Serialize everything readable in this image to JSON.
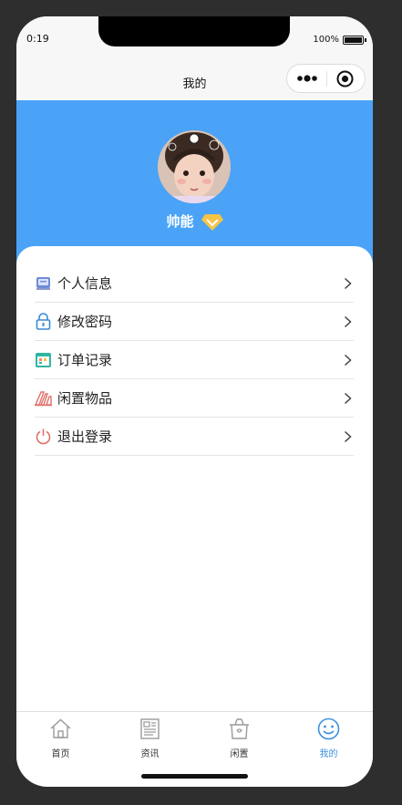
{
  "status_bar": {
    "time": "0:19",
    "battery": "100%"
  },
  "nav": {
    "title": "我的"
  },
  "profile": {
    "username": "帅能"
  },
  "menu": [
    {
      "label": "个人信息",
      "icon": "id-card-icon"
    },
    {
      "label": "修改密码",
      "icon": "lock-icon"
    },
    {
      "label": "订单记录",
      "icon": "calendar-icon"
    },
    {
      "label": "闲置物品",
      "icon": "goods-icon"
    },
    {
      "label": "退出登录",
      "icon": "power-icon"
    }
  ],
  "tabs": [
    {
      "label": "首页",
      "icon": "home-icon",
      "active": false
    },
    {
      "label": "资讯",
      "icon": "news-icon",
      "active": false
    },
    {
      "label": "闲置",
      "icon": "idle-basket-icon",
      "active": false
    },
    {
      "label": "我的",
      "icon": "smile-icon",
      "active": true
    }
  ],
  "colors": {
    "header_blue": "#4aa3f7",
    "active_tab": "#3d8fe0"
  }
}
